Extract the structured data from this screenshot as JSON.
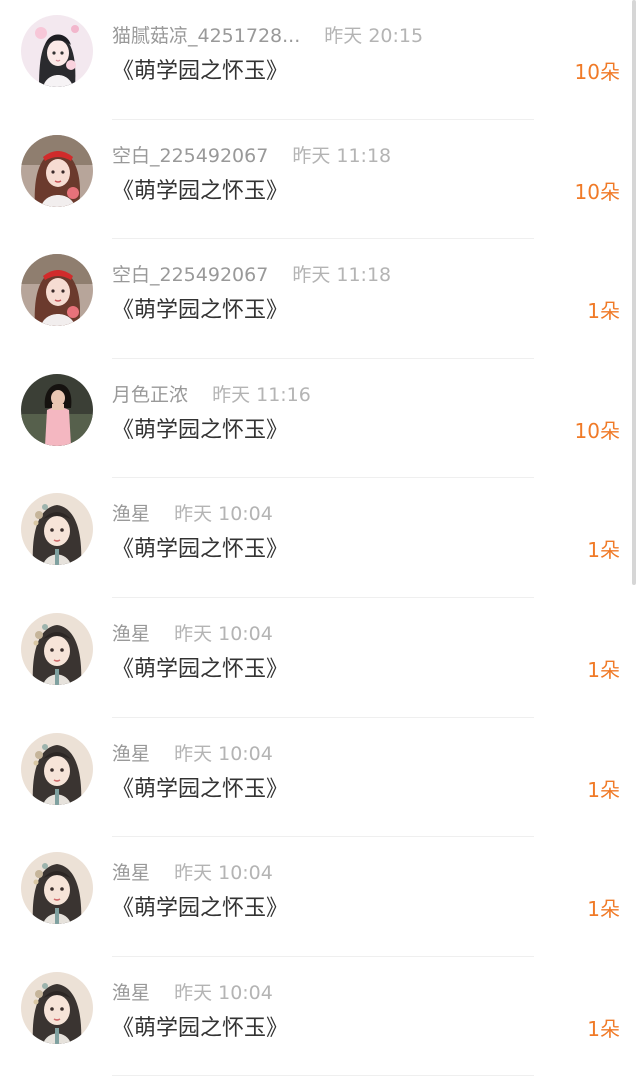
{
  "gift_records": [
    {
      "user": "猫腻菇凉_4251728...",
      "time": "昨天 20:15",
      "title": "《萌学园之怀玉》",
      "amount": "10朵",
      "avatar": "anime-girl-pink"
    },
    {
      "user": "空白_225492067",
      "time": "昨天 11:18",
      "title": "《萌学园之怀玉》",
      "amount": "10朵",
      "avatar": "girl-red-bow"
    },
    {
      "user": "空白_225492067",
      "time": "昨天 11:18",
      "title": "《萌学园之怀玉》",
      "amount": "1朵",
      "avatar": "girl-red-bow"
    },
    {
      "user": "月色正浓",
      "time": "昨天 11:16",
      "title": "《萌学园之怀玉》",
      "amount": "10朵",
      "avatar": "girl-pink-shirt"
    },
    {
      "user": "渔星",
      "time": "昨天 10:04",
      "title": "《萌学园之怀玉》",
      "amount": "1朵",
      "avatar": "ancient-style-girl"
    },
    {
      "user": "渔星",
      "time": "昨天 10:04",
      "title": "《萌学园之怀玉》",
      "amount": "1朵",
      "avatar": "ancient-style-girl"
    },
    {
      "user": "渔星",
      "time": "昨天 10:04",
      "title": "《萌学园之怀玉》",
      "amount": "1朵",
      "avatar": "ancient-style-girl"
    },
    {
      "user": "渔星",
      "time": "昨天 10:04",
      "title": "《萌学园之怀玉》",
      "amount": "1朵",
      "avatar": "ancient-style-girl"
    },
    {
      "user": "渔星",
      "time": "昨天 10:04",
      "title": "《萌学园之怀玉》",
      "amount": "1朵",
      "avatar": "ancient-style-girl"
    }
  ],
  "colors": {
    "amount": "#f07a27",
    "username": "#999999",
    "timestamp": "#b4b4b4",
    "title": "#333333",
    "divider": "#efefef"
  }
}
